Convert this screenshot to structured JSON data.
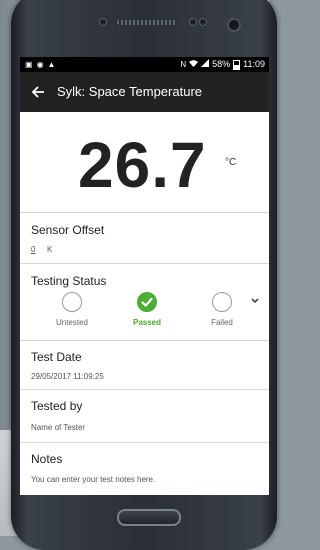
{
  "status_bar": {
    "right_text": "58%",
    "time": "11:09"
  },
  "app_bar": {
    "title": "Sylk: Space Temperature"
  },
  "reading": {
    "value": "26.7",
    "unit": "°C"
  },
  "sensor_offset": {
    "title": "Sensor Offset",
    "value": "0",
    "unit": "K"
  },
  "testing_status": {
    "title": "Testing Status",
    "options": [
      {
        "label": "Untested",
        "selected": false
      },
      {
        "label": "Passed",
        "selected": true
      },
      {
        "label": "Failed",
        "selected": false
      }
    ],
    "colors": {
      "passed": "#4cae34"
    }
  },
  "test_date": {
    "title": "Test Date",
    "value": "29/05/2017 11:09:25"
  },
  "tested_by": {
    "title": "Tested by",
    "placeholder": "Name of Tester"
  },
  "notes": {
    "title": "Notes",
    "placeholder": "You can enter your test notes here."
  },
  "icons": [
    "back-arrow-icon",
    "check-icon",
    "chevron-down-icon",
    "wifi-icon",
    "signal-icon",
    "battery-icon",
    "nfc-icon"
  ]
}
